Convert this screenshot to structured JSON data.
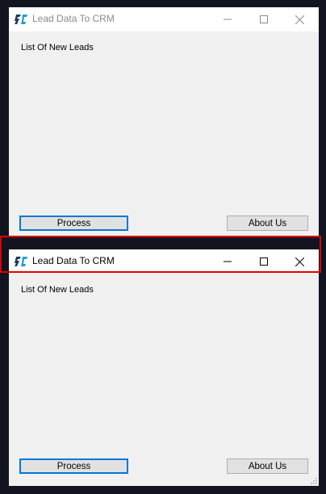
{
  "windows": [
    {
      "state": "inactive",
      "title": "Lead Data To CRM",
      "content_label": "List Of New Leads",
      "process_label": "Process",
      "about_label": "About Us"
    },
    {
      "state": "active",
      "title": "Lead Data To CRM",
      "content_label": "List Of New Leads",
      "process_label": "Process",
      "about_label": "About Us"
    }
  ],
  "icons": {
    "app": "app-logo-icon",
    "minimize": "minimize-icon",
    "maximize": "maximize-icon",
    "close": "close-icon"
  },
  "colors": {
    "highlight": "#e00000",
    "primary_button_border": "#0078d7",
    "window_bg": "#f0f0f0",
    "desktop_bg": "#12151f"
  }
}
